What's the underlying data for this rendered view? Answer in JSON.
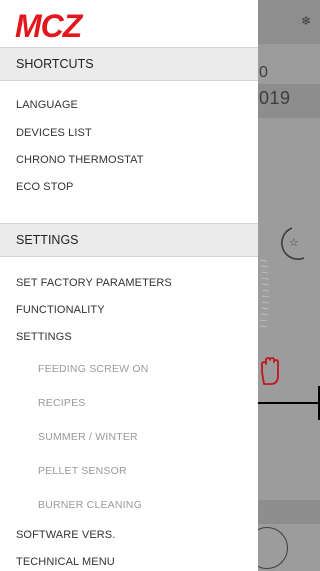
{
  "background": {
    "date_fragment_1": "0",
    "date_fragment_2": "019",
    "snow_icon": "snowflake-icon",
    "moon_icon": "moon-star-icon",
    "hand_icon": "hand-icon"
  },
  "drawer": {
    "logo_text": "MCZ",
    "sections": {
      "shortcuts": "SHORTCUTS",
      "settings": "SETTINGS"
    },
    "shortcuts_items": {
      "language": "LANGUAGE",
      "devices_list": "DEVICES LIST",
      "chrono_thermostat": "CHRONO THERMOSTAT",
      "eco_stop": "ECO STOP"
    },
    "settings_items": {
      "set_factory_parameters": "SET FACTORY PARAMETERS",
      "functionality": "FUNCTIONALITY",
      "settings": "SETTINGS",
      "feeding_screw_on": "FEEDING SCREW ON",
      "recipes": "RECIPES",
      "summer_winter": "SUMMER / WINTER",
      "pellet_sensor": "PELLET SENSOR",
      "burner_cleaning": "BURNER CLEANING",
      "software_vers": "SOFTWARE VERS.",
      "technical_menu": "TECHNICAL MENU"
    }
  },
  "colors": {
    "brand_red": "#e3181f",
    "overlay_gray": "#9c9c9c",
    "section_bg": "#ebebeb"
  }
}
